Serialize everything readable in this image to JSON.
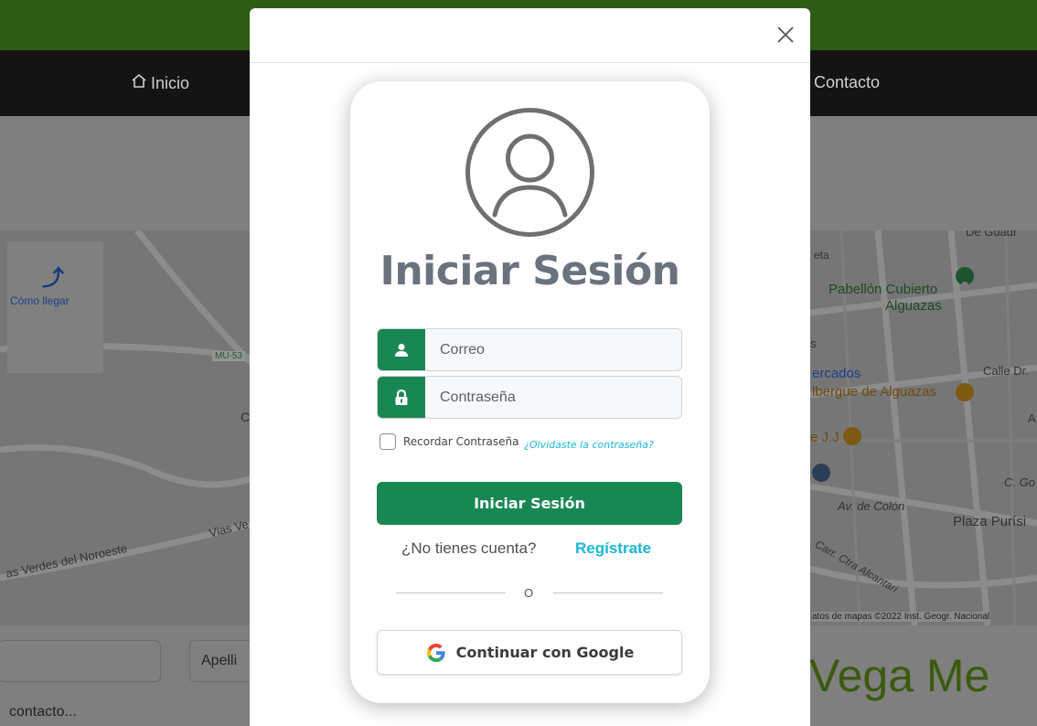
{
  "nav": {
    "home": "Inicio",
    "contact": "Contacto"
  },
  "map": {
    "directions_label": "Cómo llegar",
    "road_badge": "MU-53",
    "labels": {
      "vias_verdes": "as Verdes del Noroeste",
      "vias_v": "Vias Ve",
      "pabellon_1": "Pabellón Cubierto",
      "pabellon_2": "Alguazas",
      "mercados": "ercados",
      "albergue": "lbergue de Alguazas",
      "jj": "e J.J",
      "calle_dr": "Calle Dr.",
      "av_colon": "Av. de Colón",
      "plaza": "Plaza Purísi",
      "carr": "Carr. Ctra Alcantari",
      "c_go": "C. Go",
      "de_guad": "De Guadr",
      "eta": "eta",
      "s": "s",
      "a": "A",
      "c": "C",
      "attribution": "atos de mapas ©2022 Inst. Geogr. Nacional"
    }
  },
  "background_form": {
    "apellidos_placeholder": "Apelli",
    "contact_placeholder": "contacto...",
    "brand": "ega Me"
  },
  "modal": {
    "title": "Iniciar Sesión",
    "email_placeholder": "Correo",
    "password_placeholder": "Contraseña",
    "remember_label": "Recordar Contraseña",
    "forgot_link": "¿Olvidaste la contraseña?",
    "submit_label": "Iniciar Sesión",
    "no_account": "¿No tienes cuenta?",
    "register_link": "Regístrate",
    "divider": "O",
    "google_label": "Continuar con Google"
  },
  "colors": {
    "primary_green": "#198754",
    "link_cyan": "#19b6d6",
    "title_gray": "#6a737d"
  },
  "icons": [
    "home-icon",
    "close-icon",
    "user-circle-icon",
    "user-icon",
    "lock-icon",
    "google-icon",
    "directions-icon",
    "map-pin-icon",
    "restaurant-icon"
  ]
}
